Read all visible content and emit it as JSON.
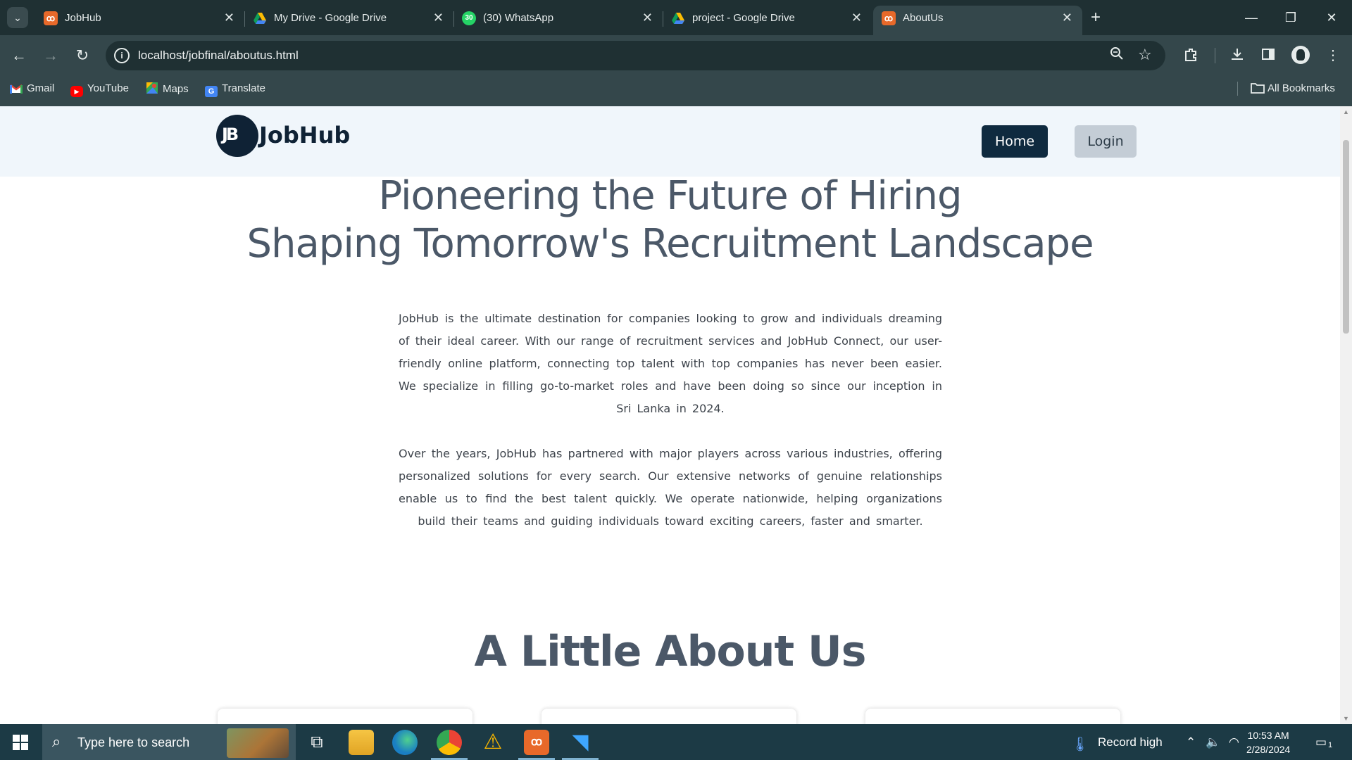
{
  "browser": {
    "tabs": [
      {
        "title": "JobHub",
        "favicon": "xampp-icon",
        "active": false
      },
      {
        "title": "My Drive - Google Drive",
        "favicon": "google-drive-icon",
        "active": false
      },
      {
        "title": "(30) WhatsApp",
        "favicon": "whatsapp-icon",
        "active": false
      },
      {
        "title": "project - Google Drive",
        "favicon": "google-drive-icon",
        "active": false
      },
      {
        "title": "AboutUs",
        "favicon": "xampp-icon",
        "active": true
      }
    ],
    "url": "localhost/jobfinal/aboutus.html",
    "bookmarks": [
      {
        "label": "Gmail",
        "icon": "gmail-icon"
      },
      {
        "label": "YouTube",
        "icon": "youtube-icon"
      },
      {
        "label": "Maps",
        "icon": "maps-icon"
      },
      {
        "label": "Translate",
        "icon": "translate-icon"
      }
    ],
    "all_bookmarks_label": "All Bookmarks",
    "whatsapp_badge": "30"
  },
  "site": {
    "brand": "JobHub",
    "logo_initials": "JB",
    "nav": {
      "home": "Home",
      "login": "Login"
    },
    "hero": {
      "line1": "Pioneering the Future of Hiring",
      "line2": "Shaping Tomorrow's Recruitment Landscape"
    },
    "paragraphs": [
      "JobHub is the ultimate destination for companies looking to grow and individuals dreaming of their ideal career. With our range of recruitment services and JobHub Connect, our user-friendly online platform, connecting top talent with top companies has never been easier. We specialize in filling go-to-market roles and have been doing so since our inception in Sri Lanka in 2024.",
      "Over the years, JobHub has partnered with major players across various industries, offering personalized solutions for every search. Our extensive networks of genuine relationships enable us to find the best talent quickly. We operate nationwide, helping organizations build their teams and guiding individuals toward exciting careers, faster and smarter."
    ],
    "section_title": "A Little About Us"
  },
  "taskbar": {
    "search_placeholder": "Type here to search",
    "weather": "Record high",
    "time": "10:53 AM",
    "date": "2/28/2024",
    "notification_count": "1"
  },
  "colors": {
    "chrome_dark": "#1f3033",
    "chrome_toolbar": "#34474b",
    "header_bg": "#f0f6fb",
    "brand_navy": "#0f2235",
    "heading_gray": "#4b5868",
    "login_btn": "#c4cdd6",
    "taskbar": "#1c3a45"
  }
}
